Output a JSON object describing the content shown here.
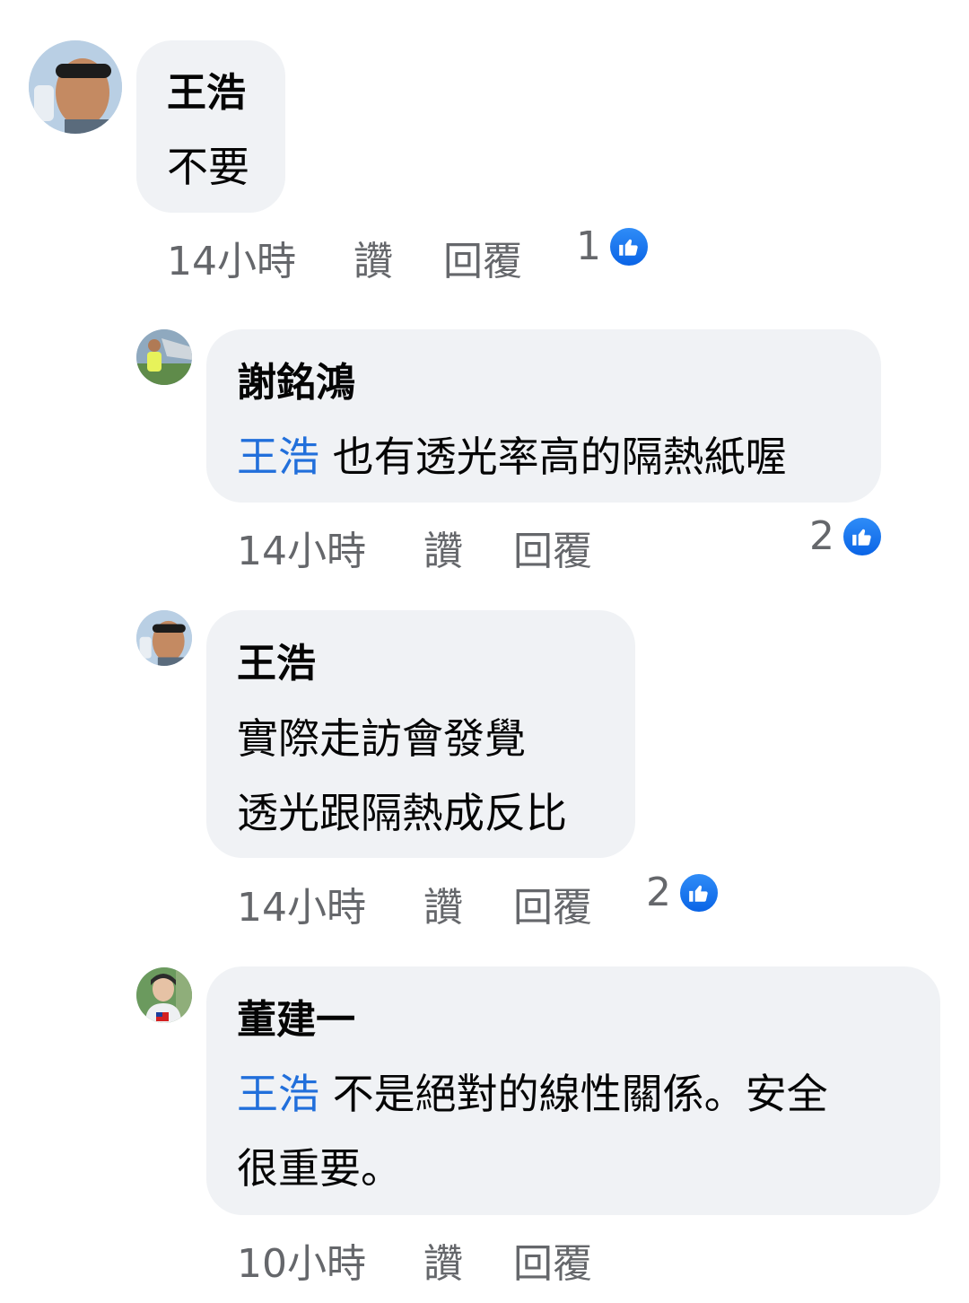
{
  "comments": [
    {
      "author": "王浩",
      "lines": [
        "不要"
      ],
      "time": "14小時",
      "like_label": "讚",
      "reply_label": "回覆",
      "reactions": "1"
    },
    {
      "author": "謝銘鴻",
      "mention": "王浩",
      "lines": [
        "也有透光率高的隔熱紙喔"
      ],
      "time": "14小時",
      "like_label": "讚",
      "reply_label": "回覆",
      "reactions": "2"
    },
    {
      "author": "王浩",
      "lines": [
        "實際走訪會發覺",
        "透光跟隔熱成反比"
      ],
      "time": "14小時",
      "like_label": "讚",
      "reply_label": "回覆",
      "reactions": "2"
    },
    {
      "author": "董建一",
      "mention": "王浩",
      "lines": [
        "不是絕對的線性關係。安全",
        "很重要。"
      ],
      "time": "10小時",
      "like_label": "讚",
      "reply_label": "回覆"
    }
  ],
  "icons": {
    "reaction": "like-thumb-icon"
  },
  "colors": {
    "mention": "#216fdb",
    "meta": "#65676b",
    "bubble": "#f0f2f5",
    "like_badge": "#1877f2"
  }
}
